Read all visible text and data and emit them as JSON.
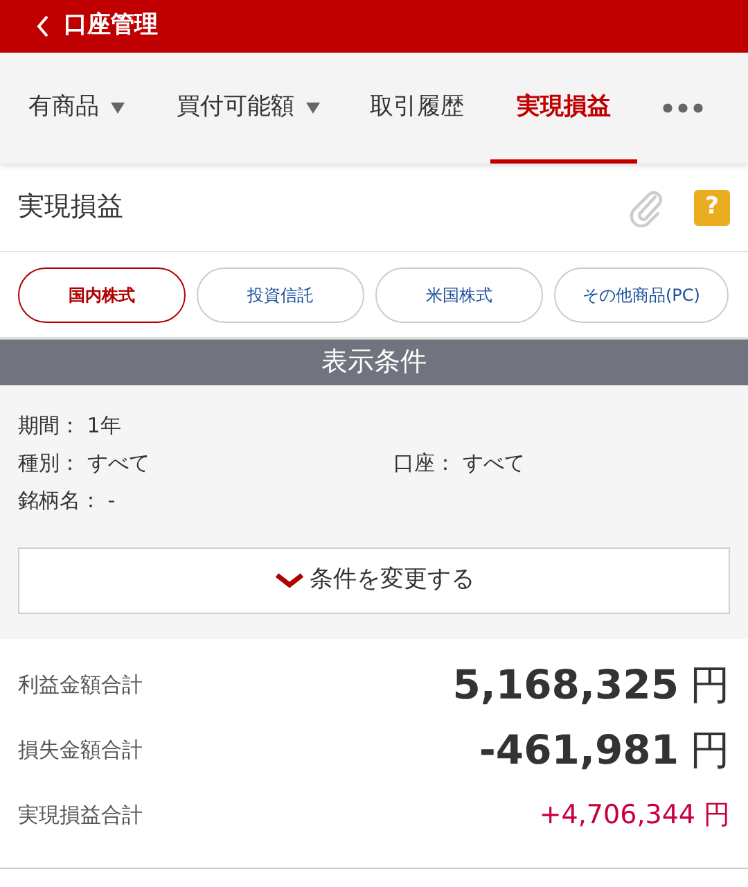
{
  "header": {
    "title": "口座管理"
  },
  "tabs": [
    {
      "label": "有商品",
      "dropdown": true,
      "selected": false
    },
    {
      "label": "買付可能額",
      "dropdown": true,
      "selected": false
    },
    {
      "label": "取引履歴",
      "dropdown": false,
      "selected": false
    },
    {
      "label": "実現損益",
      "dropdown": false,
      "selected": true
    }
  ],
  "page_title": "実現損益",
  "help_label": "?",
  "chips": [
    {
      "label": "国内株式",
      "selected": true
    },
    {
      "label": "投資信託",
      "selected": false
    },
    {
      "label": "米国株式",
      "selected": false
    },
    {
      "label": "その他商品(PC)",
      "selected": false
    }
  ],
  "conditions": {
    "heading": "表示条件",
    "rows": [
      [
        {
          "label": "期間：",
          "value": "1年"
        }
      ],
      [
        {
          "label": "種別：",
          "value": "すべて"
        },
        {
          "label": "口座：",
          "value": "すべて"
        }
      ],
      [
        {
          "label": "銘柄名：",
          "value": "-"
        }
      ]
    ],
    "change_button": "条件を変更する"
  },
  "summary": [
    {
      "label": "利益金額合計",
      "value": "5,168,325",
      "unit": "円",
      "kind": "large"
    },
    {
      "label": "損失金額合計",
      "value": "-461,981",
      "unit": "円",
      "kind": "large"
    },
    {
      "label": "実現損益合計",
      "value": "+4,706,344",
      "unit": "円",
      "kind": "signed"
    }
  ]
}
